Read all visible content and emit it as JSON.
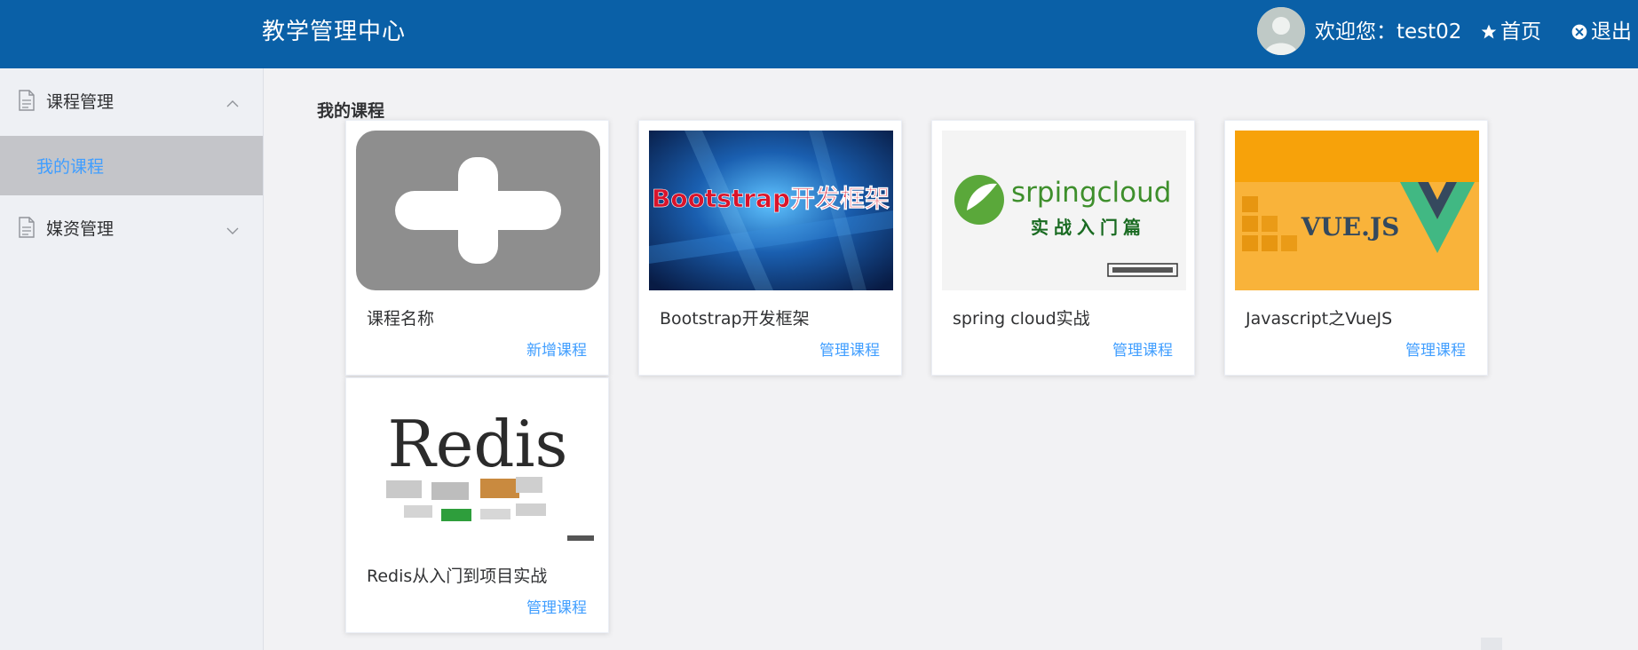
{
  "header": {
    "title": "教学管理中心",
    "welcome": "欢迎您：test02",
    "home_label": "首页",
    "logout_label": "退出"
  },
  "sidebar": {
    "groups": [
      {
        "label": "课程管理",
        "expanded": true,
        "items": [
          {
            "label": "我的课程",
            "active": true
          }
        ]
      },
      {
        "label": "媒资管理",
        "expanded": false,
        "items": []
      }
    ]
  },
  "main": {
    "section_title": "我的课程",
    "cards": [
      {
        "name": "课程名称",
        "action": "新增课程",
        "thumb": "add-placeholder"
      },
      {
        "name": "Bootstrap开发框架",
        "action": "管理课程",
        "thumb": "bootstrap",
        "thumb_text": "Bootstrap开发框架"
      },
      {
        "name": "spring cloud实战",
        "action": "管理课程",
        "thumb": "springcloud",
        "thumb_text": "srpingcloud",
        "thumb_sub": "实战入门篇"
      },
      {
        "name": "Javascript之VueJS",
        "action": "管理课程",
        "thumb": "vuejs",
        "thumb_text": "VUE.JS"
      },
      {
        "name": "Redis从入门到项目实战",
        "action": "管理课程",
        "thumb": "redis",
        "thumb_text": "Redis"
      }
    ]
  },
  "colors": {
    "header_bg": "#0a60a7",
    "active_link": "#409eff",
    "sidebar_bg": "#eef0f4",
    "active_item_bg": "#c4c5c9"
  }
}
